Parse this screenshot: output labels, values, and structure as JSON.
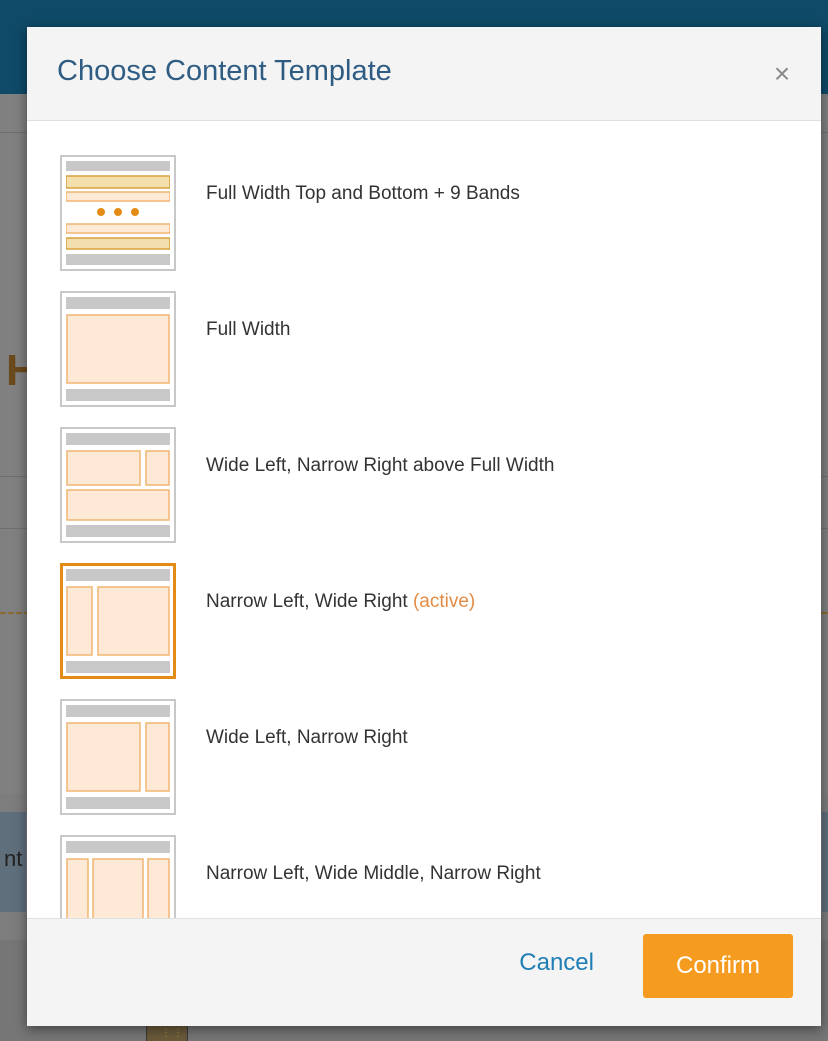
{
  "background": {
    "partial_letter": "H",
    "partial_tab_text": "nt"
  },
  "modal": {
    "title": "Choose Content Template",
    "close_icon": "×",
    "templates": [
      {
        "label": "Full Width Top and Bottom + 9 Bands",
        "layout": "bands",
        "active": false
      },
      {
        "label": "Full Width",
        "layout": "full-width",
        "active": false
      },
      {
        "label": "Wide Left, Narrow Right above Full Width",
        "layout": "wide-left-narrow-right-above-full",
        "active": false
      },
      {
        "label": "Narrow Left, Wide Right",
        "active_tag": "(active)",
        "layout": "narrow-left-wide-right",
        "active": true
      },
      {
        "label": "Wide Left, Narrow Right",
        "layout": "wide-left-narrow-right",
        "active": false
      },
      {
        "label": "Narrow Left, Wide Middle, Narrow Right",
        "layout": "narrow-wide-narrow",
        "active": false
      }
    ],
    "footer": {
      "cancel_label": "Cancel",
      "confirm_label": "Confirm"
    }
  },
  "colors": {
    "title": "#2e5c82",
    "accent": "#f59b1f",
    "active_border": "#e38b14",
    "active_tag": "#e38b43",
    "link": "#1f7fb5",
    "block_fill": "#fde9d6",
    "block_border": "#f0b571",
    "band_fill": "#f3dfae",
    "band_border": "#d9a23b",
    "gray_bar": "#c8c8c8"
  }
}
